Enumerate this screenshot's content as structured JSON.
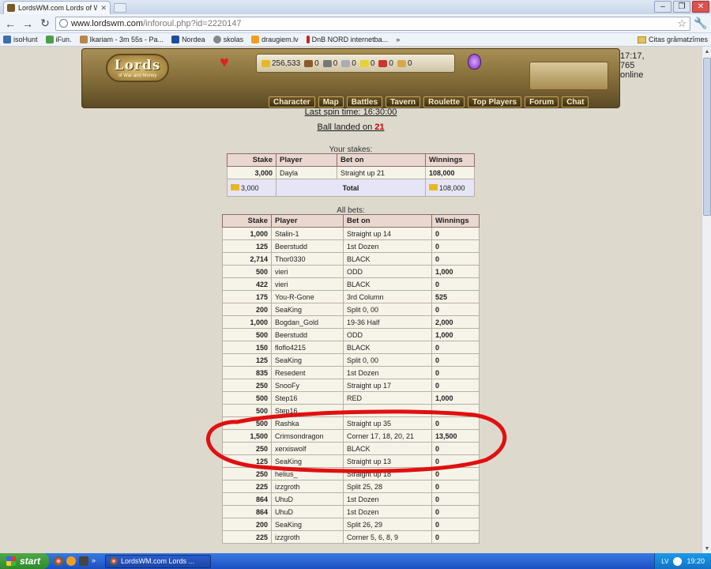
{
  "browser": {
    "tab_title": "LordsWM.com Lords of War ar",
    "url_host": "www.lordswm.com",
    "url_path": "/inforoul.php?id=2220147",
    "bookmarks": [
      "isoHunt",
      "iFun.",
      "Ikariam - 3m 55s - Pa...",
      "Nordea",
      "skolas",
      "draugiem.lv",
      "DnB NORD internetba..."
    ],
    "other_bookmarks": "Citas grāmatzīmes",
    "more_bookmarks": "»"
  },
  "header": {
    "logo_text": "Lords",
    "logo_subtext": "of War and Money",
    "gold": "256,533",
    "resources": [
      "0",
      "0",
      "0",
      "0",
      "0",
      "0"
    ],
    "online": "17:17, 765 online",
    "menu": [
      "Character",
      "Map",
      "Battles",
      "Tavern",
      "Roulette",
      "Top Players",
      "Forum",
      "Chat"
    ]
  },
  "roulette": {
    "last_spin": "Last spin time: 16:30:00",
    "ball_prefix": "Ball landed on ",
    "ball_number": "21",
    "your_stakes_caption": "Your stakes:",
    "all_bets_caption": "All bets:",
    "headers": {
      "stake": "Stake",
      "player": "Player",
      "bet_on": "Bet on",
      "winnings": "Winnings"
    },
    "your_stakes": [
      {
        "stake": "3,000",
        "player": "Dayla",
        "bet_on": "Straight up 21",
        "winnings": "108,000"
      }
    ],
    "your_total": {
      "stake": "3,000",
      "label": "Total",
      "winnings": "108,000"
    },
    "all_bets": [
      {
        "stake": "1,000",
        "player": "Stalin-1",
        "bet_on": "Straight up 14",
        "winnings": "0"
      },
      {
        "stake": "125",
        "player": "Beerstudd",
        "bet_on": "1st Dozen",
        "winnings": "0"
      },
      {
        "stake": "2,714",
        "player": "Thor0330",
        "bet_on": "BLACK",
        "winnings": "0"
      },
      {
        "stake": "500",
        "player": "vieri",
        "bet_on": "ODD",
        "winnings": "1,000"
      },
      {
        "stake": "422",
        "player": "vieri",
        "bet_on": "BLACK",
        "winnings": "0"
      },
      {
        "stake": "175",
        "player": "You-R-Gone",
        "bet_on": "3rd Column",
        "winnings": "525"
      },
      {
        "stake": "200",
        "player": "SeaKing",
        "bet_on": "Split 0, 00",
        "winnings": "0"
      },
      {
        "stake": "1,000",
        "player": "Bogdan_Gold",
        "bet_on": "19-36 Half",
        "winnings": "2,000"
      },
      {
        "stake": "500",
        "player": "Beerstudd",
        "bet_on": "ODD",
        "winnings": "1,000"
      },
      {
        "stake": "150",
        "player": "floflo4215",
        "bet_on": "BLACK",
        "winnings": "0"
      },
      {
        "stake": "125",
        "player": "SeaKing",
        "bet_on": "Split 0, 00",
        "winnings": "0"
      },
      {
        "stake": "835",
        "player": "Resedent",
        "bet_on": "1st Dozen",
        "winnings": "0"
      },
      {
        "stake": "250",
        "player": "SnooFy",
        "bet_on": "Straight up 17",
        "winnings": "0"
      },
      {
        "stake": "500",
        "player": "Step16",
        "bet_on": "RED",
        "winnings": "1,000"
      },
      {
        "stake": "500",
        "player": "Step16",
        "bet_on": "",
        "winnings": ""
      },
      {
        "stake": "500",
        "player": "Rashka",
        "bet_on": "Straight up 35",
        "winnings": "0"
      },
      {
        "stake": "1,500",
        "player": "Crimsondragon",
        "bet_on": "Corner 17, 18, 20, 21",
        "winnings": "13,500"
      },
      {
        "stake": "250",
        "player": "xerxiswolf",
        "bet_on": "BLACK",
        "winnings": "0"
      },
      {
        "stake": "125",
        "player": "SeaKing",
        "bet_on": "Straight up 13",
        "winnings": "0"
      },
      {
        "stake": "250",
        "player": "helius_",
        "bet_on": "Straight up 18",
        "winnings": "0"
      },
      {
        "stake": "225",
        "player": "izzgroth",
        "bet_on": "Split 25, 28",
        "winnings": "0"
      },
      {
        "stake": "864",
        "player": "UhuD",
        "bet_on": "1st Dozen",
        "winnings": "0"
      },
      {
        "stake": "864",
        "player": "UhuD",
        "bet_on": "1st Dozen",
        "winnings": "0"
      },
      {
        "stake": "200",
        "player": "SeaKing",
        "bet_on": "Split 26, 29",
        "winnings": "0"
      },
      {
        "stake": "225",
        "player": "izzgroth",
        "bet_on": "Corner 5, 6, 8, 9",
        "winnings": "0"
      }
    ]
  },
  "taskbar": {
    "start": "start",
    "more": "»",
    "task": "LordsWM.com Lords ...",
    "lang": "LV",
    "clock": "19:20"
  },
  "colors": {
    "annotation": "#e01010",
    "page_bg": "#ddd9cd",
    "header_cell": "#ead7cf",
    "ball_number": "#cc0000"
  }
}
